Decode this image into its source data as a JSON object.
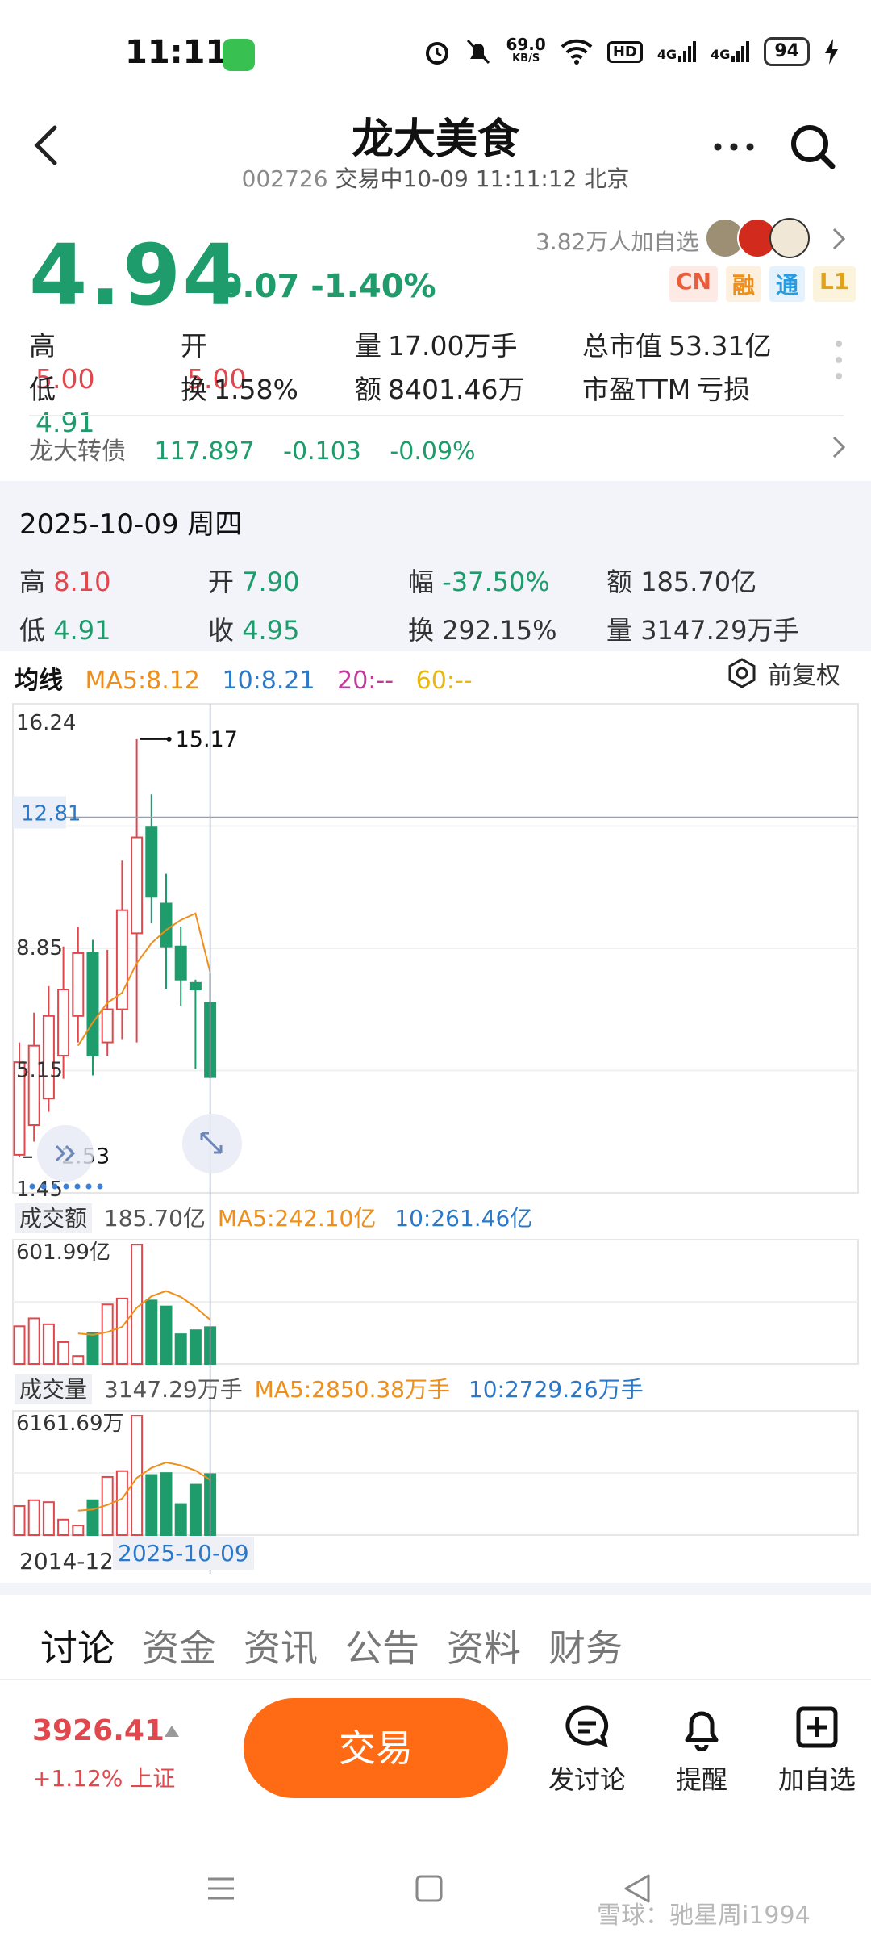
{
  "status_bar": {
    "time": "11:11",
    "net_speed": "69.0",
    "net_unit": "KB/S",
    "signal_1": "4G",
    "signal_2": "4G",
    "hd": "HD",
    "battery": "94"
  },
  "header": {
    "title": "龙大美食",
    "code": "002726",
    "status": "交易中10-09 11:11:12 北京"
  },
  "quote": {
    "price": "4.94",
    "change": "-0.07",
    "change_pct": "-1.40%",
    "followers": "3.82万人加自选",
    "badges": [
      "CN",
      "融",
      "通",
      "L1"
    ],
    "high_label": "高",
    "high": "5.00",
    "open_label": "开",
    "open": "5.00",
    "vol_label": "量",
    "vol": "17.00万手",
    "mcap_label": "总市值",
    "mcap": "53.31亿",
    "low_label": "低",
    "low": "4.91",
    "turnover_label": "换",
    "turnover": "1.58%",
    "amount_label": "额",
    "amount": "8401.46万",
    "pe_label": "市盈TTM",
    "pe": "亏损"
  },
  "convertible_bond": {
    "name": "龙大转债",
    "price": "117.897",
    "change": "-0.103",
    "change_pct": "-0.09%"
  },
  "day_info": {
    "date": "2025-10-09 周四",
    "high_label": "高",
    "high": "8.10",
    "open_label": "开",
    "open": "7.90",
    "amp_label": "幅",
    "amp": "-37.50%",
    "amount_label": "额",
    "amount": "185.70亿",
    "low_label": "低",
    "low": "4.91",
    "close_label": "收",
    "close": "4.95",
    "turnover_label": "换",
    "turnover": "292.15%",
    "vol_label": "量",
    "vol": "3147.29万手"
  },
  "ma_legend": {
    "label": "均线",
    "ma5": "MA5:8.12",
    "ma10": "10:8.21",
    "ma20": "20:--",
    "ma60": "60:--",
    "adjust": "前复权"
  },
  "chart_data": {
    "type": "candlestick",
    "price_axis": {
      "ticks": [
        "16.24",
        "12.81",
        "8.85",
        "5.15",
        "1.45"
      ],
      "ylim": [
        1.45,
        16.24
      ]
    },
    "annotations": {
      "max": "15.17",
      "min": "2.53",
      "crosshair": "12.81"
    },
    "candles": [
      {
        "o": 2.6,
        "c": 5.4,
        "h": 6.0,
        "l": 2.53
      },
      {
        "o": 3.5,
        "c": 5.9,
        "h": 6.9,
        "l": 3.0
      },
      {
        "o": 4.3,
        "c": 6.8,
        "h": 7.7,
        "l": 3.9
      },
      {
        "o": 5.6,
        "c": 7.6,
        "h": 8.9,
        "l": 4.9
      },
      {
        "o": 6.8,
        "c": 8.7,
        "h": 9.5,
        "l": 6.0
      },
      {
        "o": 8.7,
        "c": 5.6,
        "h": 9.1,
        "l": 5.0
      },
      {
        "o": 6.0,
        "c": 7.0,
        "h": 8.8,
        "l": 5.6
      },
      {
        "o": 7.0,
        "c": 10.0,
        "h": 11.5,
        "l": 6.1
      },
      {
        "o": 9.3,
        "c": 12.2,
        "h": 15.17,
        "l": 6.0
      },
      {
        "o": 12.5,
        "c": 10.4,
        "h": 13.5,
        "l": 9.6
      },
      {
        "o": 10.2,
        "c": 8.9,
        "h": 11.1,
        "l": 7.6
      },
      {
        "o": 8.9,
        "c": 7.9,
        "h": 9.5,
        "l": 7.1
      },
      {
        "o": 7.8,
        "c": 7.6,
        "h": 7.9,
        "l": 5.2
      },
      {
        "o": 7.2,
        "c": 4.95,
        "h": 8.1,
        "l": 4.91
      }
    ],
    "ma_line": [
      null,
      null,
      null,
      null,
      5.9,
      6.6,
      7.2,
      7.5,
      8.4,
      9.0,
      9.4,
      9.7,
      9.9,
      8.12
    ],
    "amount_panel": {
      "label": "成交额",
      "value": "185.70亿",
      "ma5": "MA5:242.10亿",
      "ma10": "10:261.46亿",
      "max_tick": "601.99亿",
      "bars": [
        190,
        230,
        200,
        110,
        40,
        155,
        300,
        330,
        601.99,
        320,
        290,
        150,
        170,
        185.7
      ],
      "ma": [
        null,
        null,
        null,
        null,
        154,
        147,
        161,
        187,
        284,
        341,
        368,
        338,
        286,
        223
      ]
    },
    "volume_panel": {
      "label": "成交量",
      "value": "3147.29万手",
      "ma5": "MA5:2850.38万手",
      "ma10": "10:2729.26万手",
      "max_tick": "6161.69万",
      "bars": [
        1500,
        1800,
        1700,
        800,
        500,
        1800,
        3000,
        3300,
        6161.69,
        3100,
        3200,
        1600,
        2600,
        3147.29
      ],
      "ma": [
        null,
        null,
        null,
        null,
        1260,
        1320,
        1560,
        1880,
        2950,
        3470,
        3750,
        3600,
        3330,
        2850
      ]
    },
    "x_labels": {
      "start": "2014-12",
      "cursor": "2025-10-09"
    }
  },
  "tabs": [
    "讨论",
    "资金",
    "资讯",
    "公告",
    "资料",
    "财务"
  ],
  "bottom_bar": {
    "index_value": "3926.41",
    "index_change": "+1.12% 上证",
    "trade": "交易",
    "discuss": "发讨论",
    "remind": "提醒",
    "watchlist": "加自选"
  },
  "watermark": "雪球：驰星周i1994",
  "colors": {
    "up": "#e0484e",
    "down": "#1f9c6b",
    "ma5": "#ef8f1a",
    "ma10": "#2b78c9",
    "trade": "#ff6a14"
  }
}
